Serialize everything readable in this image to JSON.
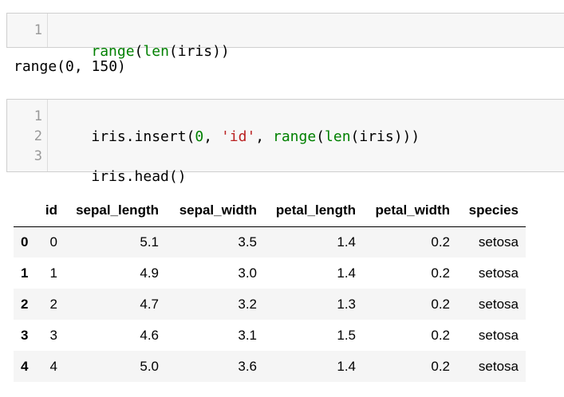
{
  "cells": [
    {
      "line_numbers": [
        "1"
      ],
      "code_lines": [
        [
          {
            "t": "fn",
            "v": "range"
          },
          {
            "t": "p",
            "v": "("
          },
          {
            "t": "fn",
            "v": "len"
          },
          {
            "t": "p",
            "v": "(iris))"
          }
        ]
      ]
    },
    {
      "line_numbers": [
        "1",
        "2",
        "3"
      ],
      "code_lines": [
        [
          {
            "t": "p",
            "v": "iris.insert("
          },
          {
            "t": "num",
            "v": "0"
          },
          {
            "t": "p",
            "v": ", "
          },
          {
            "t": "str",
            "v": "'id'"
          },
          {
            "t": "p",
            "v": ", "
          },
          {
            "t": "fn",
            "v": "range"
          },
          {
            "t": "p",
            "v": "("
          },
          {
            "t": "fn",
            "v": "len"
          },
          {
            "t": "p",
            "v": "(iris)))"
          }
        ],
        [],
        [
          {
            "t": "p",
            "v": "iris.head()"
          }
        ]
      ]
    }
  ],
  "output1": {
    "text": "range(0, 150)"
  },
  "dataframe": {
    "columns": [
      "",
      "id",
      "sepal_length",
      "sepal_width",
      "petal_length",
      "petal_width",
      "species"
    ],
    "rows": [
      {
        "index": "0",
        "cells": [
          "0",
          "5.1",
          "3.5",
          "1.4",
          "0.2",
          "setosa"
        ]
      },
      {
        "index": "1",
        "cells": [
          "1",
          "4.9",
          "3.0",
          "1.4",
          "0.2",
          "setosa"
        ]
      },
      {
        "index": "2",
        "cells": [
          "2",
          "4.7",
          "3.2",
          "1.3",
          "0.2",
          "setosa"
        ]
      },
      {
        "index": "3",
        "cells": [
          "3",
          "4.6",
          "3.1",
          "1.5",
          "0.2",
          "setosa"
        ]
      },
      {
        "index": "4",
        "cells": [
          "4",
          "5.0",
          "3.6",
          "1.4",
          "0.2",
          "setosa"
        ]
      }
    ]
  },
  "colors": {
    "cell_bg": "#f7f7f7",
    "builtin": "#008000",
    "string": "#ba2121",
    "line_number": "#999999",
    "row_stripe": "#f5f5f5"
  }
}
